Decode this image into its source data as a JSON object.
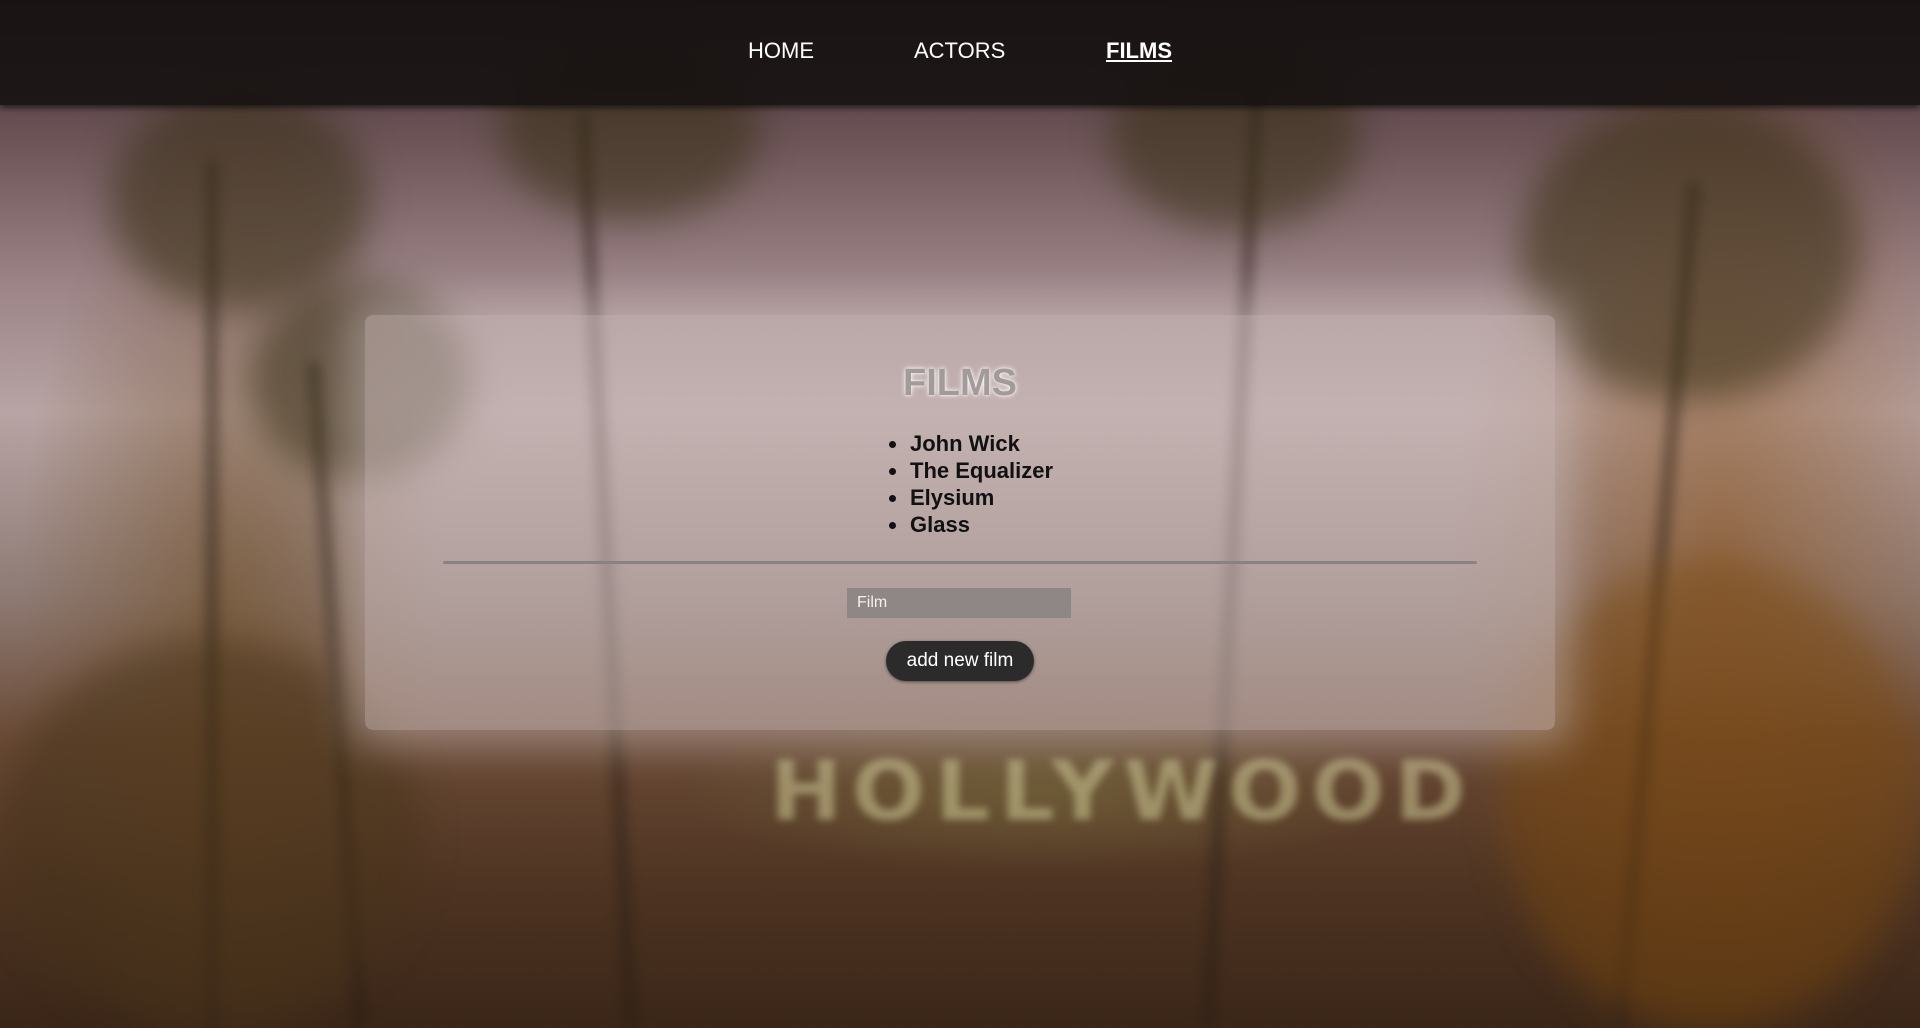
{
  "nav": {
    "items": [
      {
        "label": "HOME",
        "active": false
      },
      {
        "label": "ACTORS",
        "active": false
      },
      {
        "label": "FILMS",
        "active": true
      }
    ]
  },
  "background": {
    "sign_text": "HOLLYWOOD"
  },
  "panel": {
    "title": "FILMS",
    "films": [
      "John Wick",
      "The Equalizer",
      "Elysium",
      "Glass"
    ],
    "input": {
      "placeholder": "Film",
      "value": ""
    },
    "add_button_label": "add new film"
  },
  "colors": {
    "nav_background": "#141010",
    "button_background": "#2b2b2b",
    "input_background": "#8f8686"
  }
}
